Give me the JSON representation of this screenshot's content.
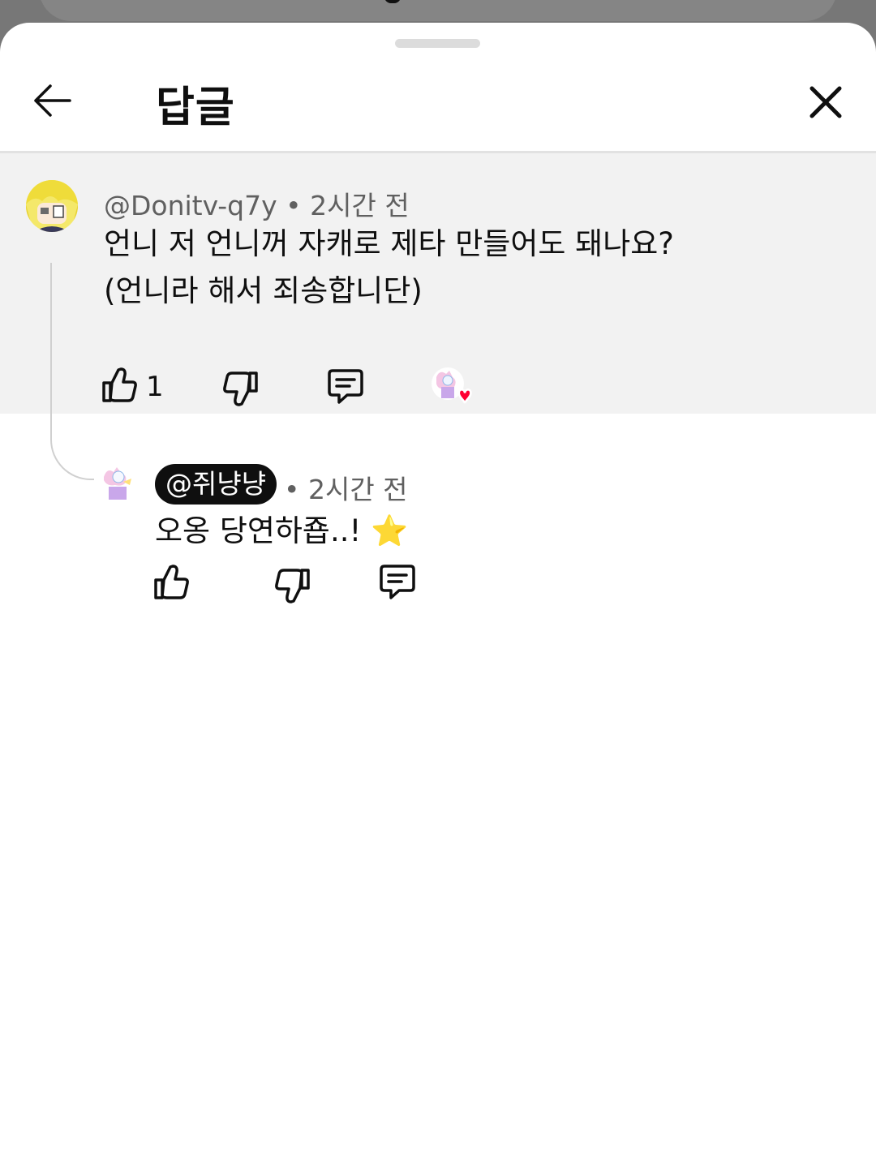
{
  "header": {
    "title": "답글"
  },
  "parent_comment": {
    "author": "@Donitv-q7y",
    "time": "2시간 전",
    "separator": "•",
    "lines": [
      "언니 저 언니꺼 자캐로 제타 만들어도 돼나요?",
      "(언니라 해서 죄송합니단)"
    ],
    "like_count": "1"
  },
  "reply": {
    "author": "@쥐냥냥",
    "time": "2시간 전",
    "separator": "•",
    "text": "오옹 당연하죱..! ⭐"
  },
  "colors": {
    "sheet_bg": "#ffffff",
    "parent_bg": "#f2f2f2",
    "heart": "#ff0033",
    "text": "#0f0f0f",
    "meta": "#606060"
  }
}
